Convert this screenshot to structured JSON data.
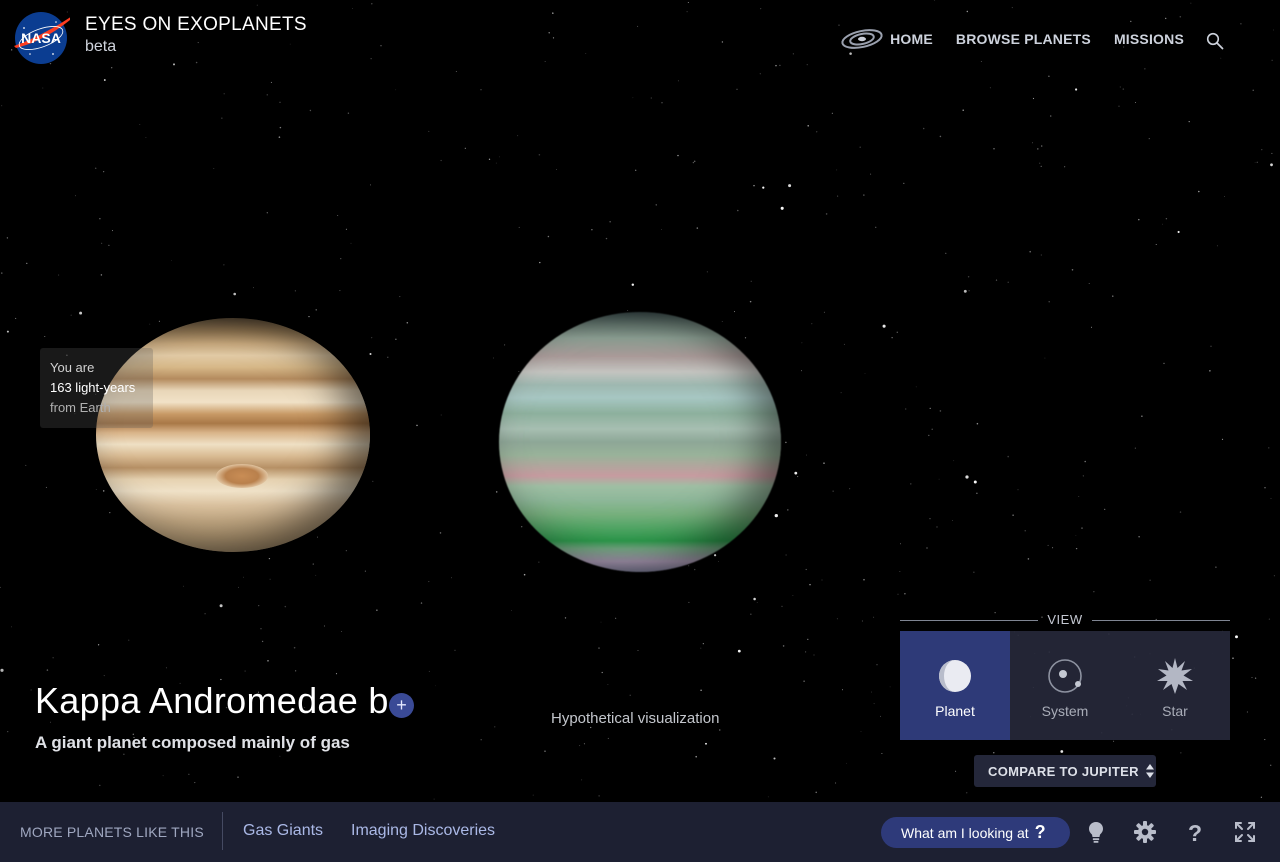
{
  "header": {
    "title": "EYES ON EXOPLANETS",
    "subtitle": "beta",
    "logo_icon": "nasa-logo",
    "nav": [
      {
        "label": "HOME",
        "icon": "galaxy-icon"
      },
      {
        "label": "BROWSE PLANETS"
      },
      {
        "label": "MISSIONS"
      }
    ],
    "search_icon": "search-icon"
  },
  "distance": {
    "line1": "You are",
    "line2": "163 light-years",
    "line3": "from Earth"
  },
  "planet": {
    "name": "Kappa Andromedae b",
    "add_symbol": "+",
    "description": "A giant planet composed mainly of gas",
    "visualization_note": "Hypothetical visualization"
  },
  "view": {
    "label": "VIEW",
    "options": [
      {
        "label": "Planet",
        "icon": "planet-icon",
        "active": true
      },
      {
        "label": "System",
        "icon": "system-icon",
        "active": false
      },
      {
        "label": "Star",
        "icon": "star-icon",
        "active": false
      }
    ]
  },
  "compare": {
    "label": "COMPARE TO JUPITER"
  },
  "bottom_bar": {
    "more_label": "MORE PLANETS LIKE THIS",
    "tags": [
      "Gas Giants",
      "Imaging Discoveries"
    ],
    "looking_label": "What am I looking at",
    "looking_symbol": "?",
    "icons": [
      "lightbulb-icon",
      "gear-icon",
      "help-icon",
      "fullscreen-icon"
    ]
  },
  "colors": {
    "background": "#000000",
    "bar": "#1d2032",
    "accent": "#2e3a78",
    "tag_link": "#aab8e6"
  }
}
